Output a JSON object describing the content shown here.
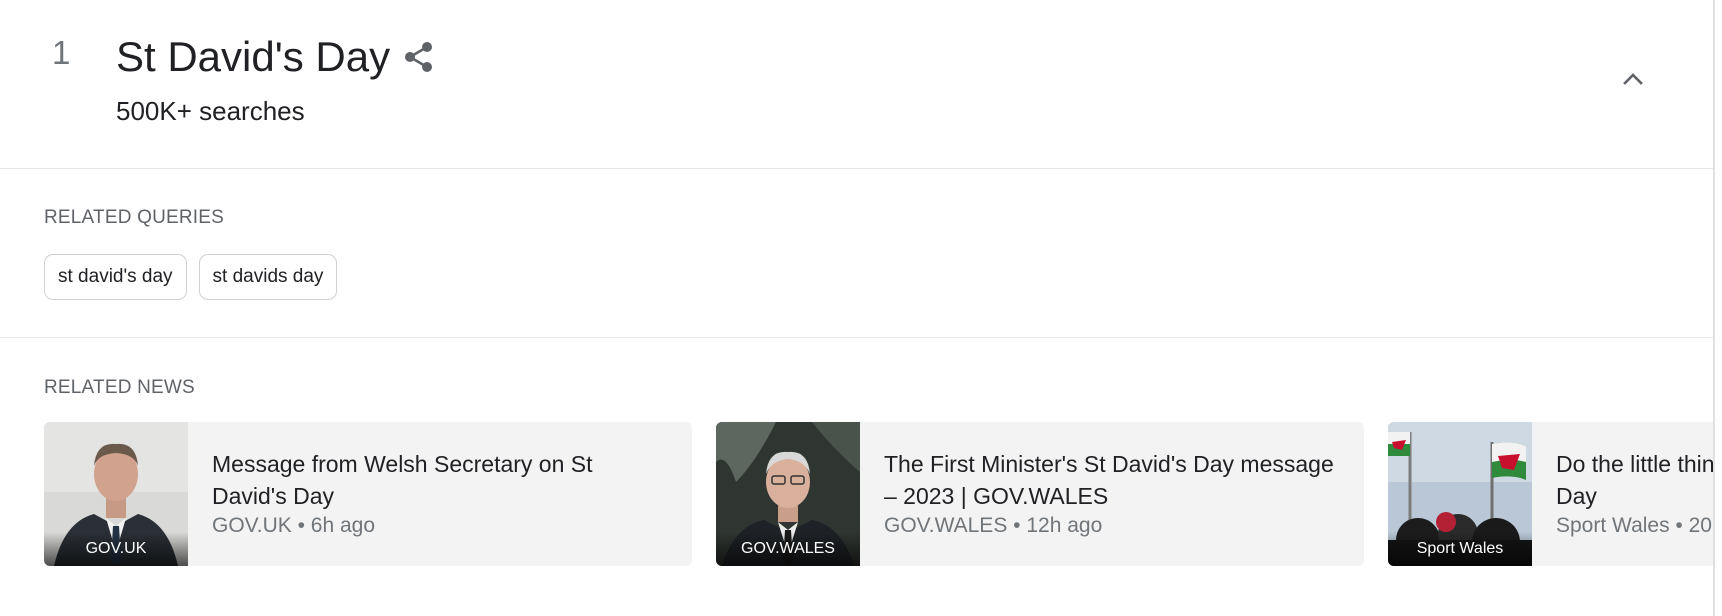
{
  "trend": {
    "rank": "1",
    "title": "St David's Day",
    "searches": "500K+ searches"
  },
  "icons": {
    "share": "share-icon",
    "collapse": "chevron-up-icon"
  },
  "related_queries": {
    "label": "RELATED QUERIES",
    "items": [
      "st david's day",
      "st davids day"
    ]
  },
  "related_news": {
    "label": "RELATED NEWS",
    "items": [
      {
        "title": "Message from Welsh Secretary on St David's Day",
        "source": "GOV.UK",
        "time": "6h ago",
        "meta": "GOV.UK • 6h ago",
        "thumb_source": "GOV.UK"
      },
      {
        "title": "The First Minister's St David's Day message – 2023 | GOV.WALES",
        "source": "GOV.WALES",
        "time": "12h ago",
        "meta": "GOV.WALES • 12h ago",
        "thumb_source": "GOV.WALES"
      },
      {
        "title": "Do the little thin",
        "title_line2": "Day",
        "source": "Sport Wales",
        "meta": "Sport Wales • 20l",
        "thumb_source": "Sport Wales"
      }
    ]
  },
  "colors": {
    "text_primary": "#202124",
    "text_secondary": "#70757a",
    "card_bg": "#f3f3f3",
    "divider": "#e6e6e6"
  }
}
